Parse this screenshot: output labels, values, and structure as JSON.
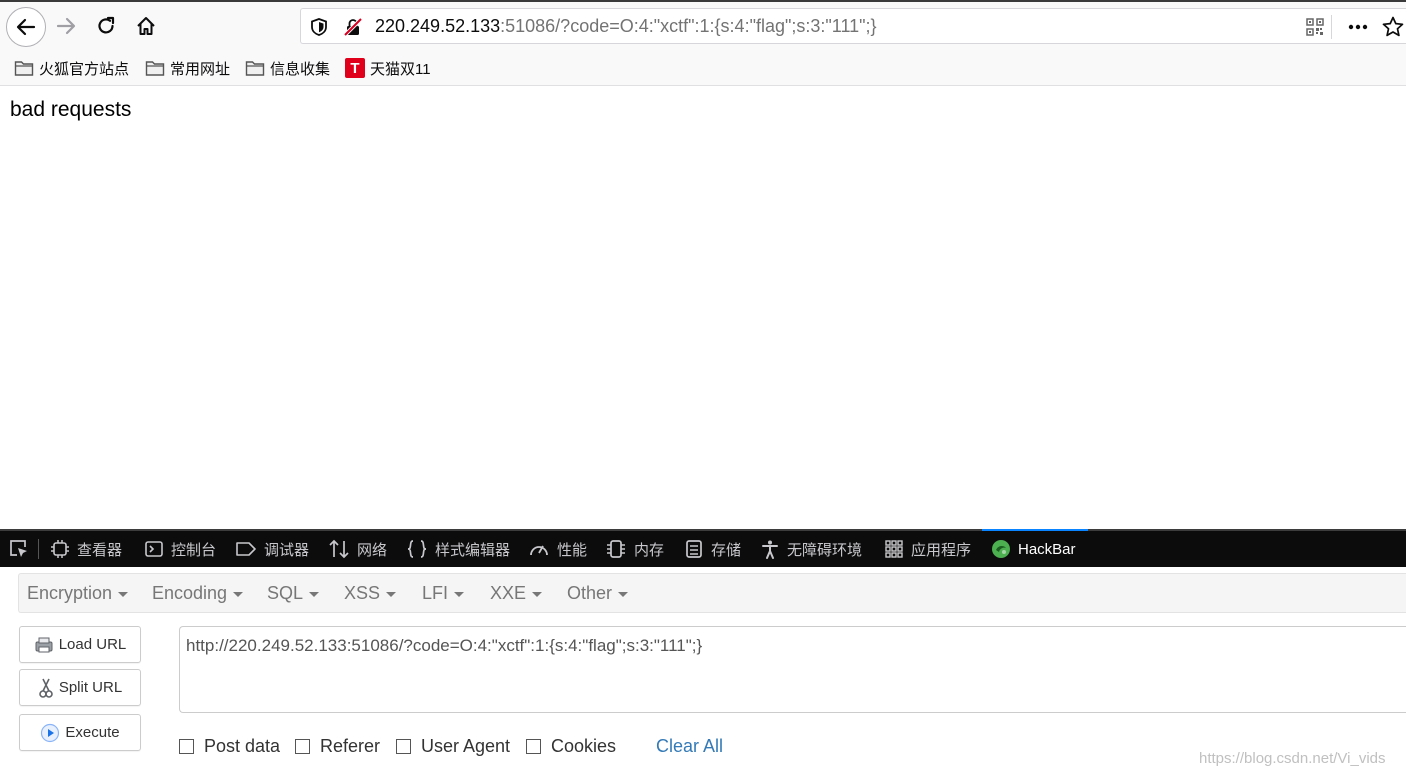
{
  "browser": {
    "url": {
      "host": "220.249.52.133",
      "rest": ":51086/?code=O:4:\"xctf\":1:{s:4:\"flag\";s:3:\"111\";}"
    },
    "bookmarks": [
      {
        "label": "火狐官方站点",
        "icon": "folder-icon"
      },
      {
        "label": "常用网址",
        "icon": "folder-icon"
      },
      {
        "label": "信息收集",
        "icon": "folder-icon"
      },
      {
        "label": "天猫双11",
        "icon": "tmall-icon",
        "icon_text": "T"
      }
    ]
  },
  "page": {
    "message": "bad requests"
  },
  "devtools": {
    "tabs": [
      {
        "label": "查看器",
        "icon": "inspector-icon"
      },
      {
        "label": "控制台",
        "icon": "console-icon"
      },
      {
        "label": "调试器",
        "icon": "debugger-icon"
      },
      {
        "label": "网络",
        "icon": "network-icon"
      },
      {
        "label": "样式编辑器",
        "icon": "style-editor-icon"
      },
      {
        "label": "性能",
        "icon": "performance-icon"
      },
      {
        "label": "内存",
        "icon": "memory-icon"
      },
      {
        "label": "存储",
        "icon": "storage-icon"
      },
      {
        "label": "无障碍环境",
        "icon": "accessibility-icon"
      },
      {
        "label": "应用程序",
        "icon": "application-icon"
      },
      {
        "label": "HackBar",
        "icon": "hackbar-icon",
        "active": true
      }
    ]
  },
  "hackbar": {
    "menu": [
      "Encryption",
      "Encoding",
      "SQL",
      "XSS",
      "LFI",
      "XXE",
      "Other"
    ],
    "buttons": {
      "load_url": "Load URL",
      "split_url": "Split URL",
      "execute": "Execute"
    },
    "url_value": "http://220.249.52.133:51086/?code=O:4:\"xctf\":1:{s:4:\"flag\";s:3:\"111\";}",
    "checkboxes": [
      {
        "label": "Post data",
        "checked": false
      },
      {
        "label": "Referer",
        "checked": false
      },
      {
        "label": "User Agent",
        "checked": false
      },
      {
        "label": "Cookies",
        "checked": false
      }
    ],
    "clear_all": "Clear All"
  },
  "watermark": "https://blog.csdn.net/Vi_vids",
  "colors": {
    "devtools_bg": "#0c0c0d",
    "active_tab_accent": "#0a84ff",
    "link": "#337ab7",
    "insecure_red": "#d70022",
    "hackbar_green": "#4caf50"
  }
}
